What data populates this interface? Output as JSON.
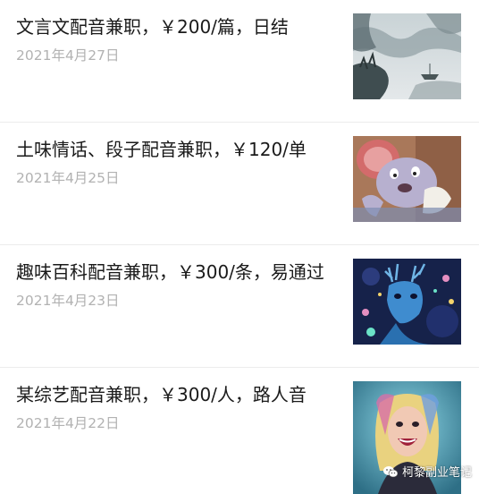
{
  "feed": {
    "items": [
      {
        "title": "文言文配音兼职，￥200/篇，日结",
        "date": "2021年4月27日",
        "thumbnail_icon": "ink-landscape-image"
      },
      {
        "title": "土味情话、段子配音兼职，￥120/单",
        "date": "2021年4月25日",
        "thumbnail_icon": "cartoon-mouse-image"
      },
      {
        "title": "趣味百科配音兼职，￥300/条，易通过",
        "date": "2021年4月23日",
        "thumbnail_icon": "blue-deer-image"
      },
      {
        "title": "某综艺配音兼职，￥300/人，路人音",
        "date": "2021年4月22日",
        "thumbnail_icon": "laughing-woman-image"
      }
    ]
  },
  "watermark": {
    "text": "柯黎副业笔记",
    "icon": "wechat-icon"
  },
  "colors": {
    "title": "#1a1a1a",
    "date": "#b2b2b2",
    "divider": "#ececec"
  }
}
